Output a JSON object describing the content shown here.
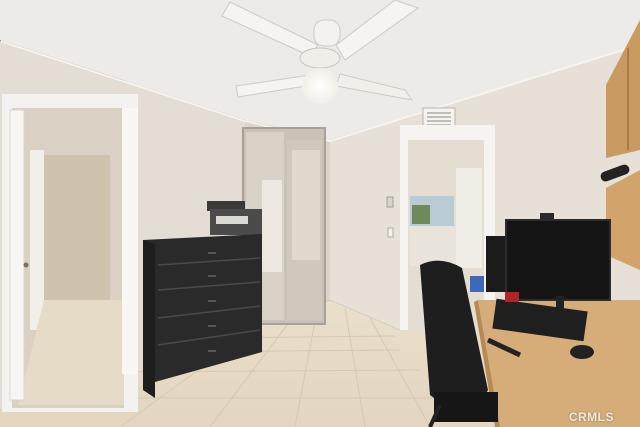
{
  "photo": {
    "subject": "bedroom-office-interior",
    "watermark": "CRMLS"
  },
  "colors": {
    "wall": "#e2dcd2",
    "ceiling": "#eceae6",
    "floor": "#e8dcc8",
    "dresser": "#2b2a2a",
    "desk": "#d6ad78",
    "cabinet": "#c99b63",
    "chair": "#202020"
  }
}
